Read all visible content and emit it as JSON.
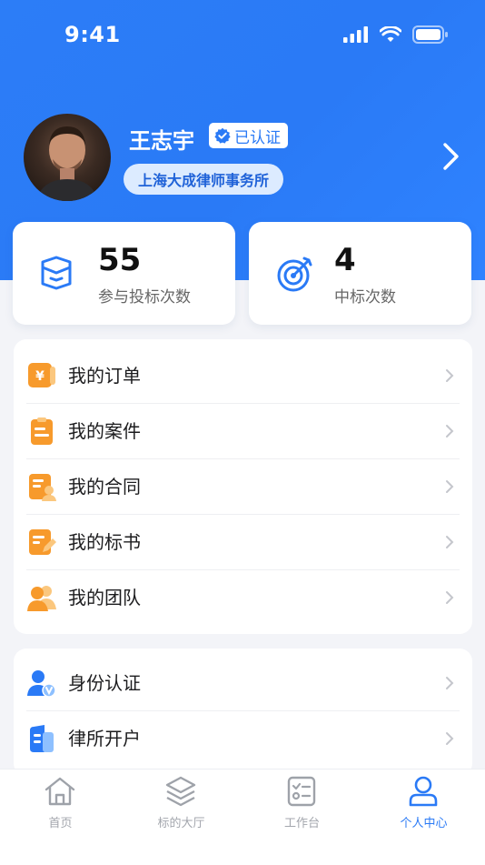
{
  "status_bar": {
    "time": "9:41"
  },
  "profile": {
    "name": "王志宇",
    "verified_label": "已认证",
    "firm": "上海大成律师事务所"
  },
  "stats": [
    {
      "value": "55",
      "label": "参与投标次数",
      "icon": "bid-icon"
    },
    {
      "value": "4",
      "label": "中标次数",
      "icon": "target-icon"
    }
  ],
  "menu_group_1": [
    {
      "label": "我的订单",
      "icon": "order-yen-icon"
    },
    {
      "label": "我的案件",
      "icon": "case-clipboard-icon"
    },
    {
      "label": "我的合同",
      "icon": "contract-icon"
    },
    {
      "label": "我的标书",
      "icon": "tender-edit-icon"
    },
    {
      "label": "我的团队",
      "icon": "team-icon"
    }
  ],
  "menu_group_2": [
    {
      "label": "身份认证",
      "icon": "identity-verify-icon"
    },
    {
      "label": "律所开户",
      "icon": "firm-account-icon"
    }
  ],
  "tabbar": [
    {
      "label": "首页",
      "icon": "home-icon",
      "active": false
    },
    {
      "label": "标的大厅",
      "icon": "layers-icon",
      "active": false
    },
    {
      "label": "工作台",
      "icon": "workbench-icon",
      "active": false
    },
    {
      "label": "个人中心",
      "icon": "user-icon",
      "active": true
    }
  ],
  "colors": {
    "primary": "#2a7af6",
    "orange": "#f5a23a",
    "background": "#f3f4f8"
  }
}
